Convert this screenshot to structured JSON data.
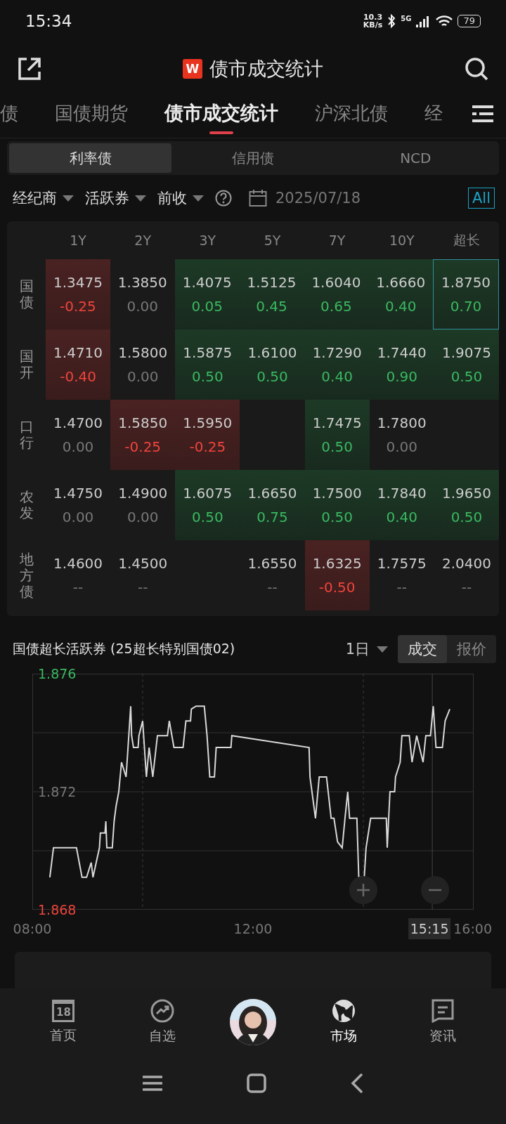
{
  "status_bar": {
    "time": "15:34",
    "net_speed": "10.3",
    "net_unit": "KB/s",
    "network": "5G",
    "battery": "79"
  },
  "header": {
    "logo": "W",
    "title": "债市成交统计"
  },
  "tabs": [
    {
      "label": "债",
      "selected": false
    },
    {
      "label": "国债期货",
      "selected": false
    },
    {
      "label": "债市成交统计",
      "selected": true
    },
    {
      "label": "沪深北债",
      "selected": false
    },
    {
      "label": "经",
      "selected": false
    }
  ],
  "segments": [
    {
      "label": "利率债",
      "selected": true
    },
    {
      "label": "信用债",
      "selected": false
    },
    {
      "label": "NCD",
      "selected": false
    }
  ],
  "filters": {
    "dropdowns": [
      "经纪商",
      "活跃券",
      "前收"
    ],
    "date": "2025/07/18",
    "all_button": "All"
  },
  "table": {
    "columns": [
      "1Y",
      "2Y",
      "3Y",
      "5Y",
      "7Y",
      "10Y",
      "超长"
    ],
    "rows": [
      {
        "name": "国债",
        "cells": [
          {
            "rate": "1.3475",
            "change": "-0.25",
            "kind": "down",
            "selected": false
          },
          {
            "rate": "1.3850",
            "change": "0.00",
            "kind": "flat",
            "selected": false
          },
          {
            "rate": "1.4075",
            "change": "0.05",
            "kind": "up",
            "selected": false
          },
          {
            "rate": "1.5125",
            "change": "0.45",
            "kind": "up",
            "selected": false
          },
          {
            "rate": "1.6040",
            "change": "0.65",
            "kind": "up",
            "selected": false
          },
          {
            "rate": "1.6660",
            "change": "0.40",
            "kind": "up",
            "selected": false
          },
          {
            "rate": "1.8750",
            "change": "0.70",
            "kind": "up",
            "selected": true
          }
        ]
      },
      {
        "name": "国开",
        "cells": [
          {
            "rate": "1.4710",
            "change": "-0.40",
            "kind": "down",
            "selected": false
          },
          {
            "rate": "1.5800",
            "change": "0.00",
            "kind": "flat",
            "selected": false
          },
          {
            "rate": "1.5875",
            "change": "0.50",
            "kind": "up",
            "selected": false
          },
          {
            "rate": "1.6100",
            "change": "0.50",
            "kind": "up",
            "selected": false
          },
          {
            "rate": "1.7290",
            "change": "0.40",
            "kind": "up",
            "selected": false
          },
          {
            "rate": "1.7440",
            "change": "0.90",
            "kind": "up",
            "selected": false
          },
          {
            "rate": "1.9075",
            "change": "0.50",
            "kind": "up",
            "selected": false
          }
        ]
      },
      {
        "name": "口行",
        "cells": [
          {
            "rate": "1.4700",
            "change": "0.00",
            "kind": "flat",
            "selected": false
          },
          {
            "rate": "1.5850",
            "change": "-0.25",
            "kind": "down",
            "selected": false
          },
          {
            "rate": "1.5950",
            "change": "-0.25",
            "kind": "down",
            "selected": false
          },
          {
            "selected": false
          },
          {
            "rate": "1.7475",
            "change": "0.50",
            "kind": "up",
            "selected": false
          },
          {
            "rate": "1.7800",
            "change": "0.00",
            "kind": "flat",
            "selected": false
          },
          {
            "selected": false
          }
        ]
      },
      {
        "name": "农发",
        "cells": [
          {
            "rate": "1.4750",
            "change": "0.00",
            "kind": "flat",
            "selected": false
          },
          {
            "rate": "1.4900",
            "change": "0.00",
            "kind": "flat",
            "selected": false
          },
          {
            "rate": "1.6075",
            "change": "0.50",
            "kind": "up",
            "selected": false
          },
          {
            "rate": "1.6650",
            "change": "0.75",
            "kind": "up",
            "selected": false
          },
          {
            "rate": "1.7500",
            "change": "0.50",
            "kind": "up",
            "selected": false
          },
          {
            "rate": "1.7840",
            "change": "0.40",
            "kind": "up",
            "selected": false
          },
          {
            "rate": "1.9650",
            "change": "0.50",
            "kind": "up",
            "selected": false
          }
        ]
      },
      {
        "name": "地方债",
        "cells": [
          {
            "rate": "1.4600",
            "change": "--",
            "kind": "flat",
            "selected": false
          },
          {
            "rate": "1.4500",
            "change": "--",
            "kind": "flat",
            "selected": false
          },
          {
            "selected": false
          },
          {
            "rate": "1.6550",
            "change": "--",
            "kind": "flat",
            "selected": false
          },
          {
            "rate": "1.6325",
            "change": "-0.50",
            "kind": "down",
            "selected": false
          },
          {
            "rate": "1.7575",
            "change": "--",
            "kind": "flat",
            "selected": false
          },
          {
            "rate": "2.0400",
            "change": "--",
            "kind": "flat",
            "selected": false
          }
        ]
      }
    ]
  },
  "chart": {
    "title": "国债超长活跃券 (25超长特别国债02)",
    "period": "1日",
    "modes": [
      {
        "label": "成交",
        "selected": true
      },
      {
        "label": "报价",
        "selected": false
      }
    ],
    "crosshair_label": "15:15",
    "chart_data": {
      "type": "line",
      "x": [
        8.317,
        8.383,
        8.8,
        8.9,
        8.983,
        9.067,
        9.1,
        9.217,
        9.233,
        9.317,
        9.333,
        9.35,
        9.45,
        9.483,
        9.517,
        9.567,
        9.617,
        9.7,
        9.717,
        9.783,
        9.8,
        9.833,
        9.917,
        9.933,
        10,
        10.067,
        10.117,
        10.183,
        10.267,
        10.317,
        10.45,
        10.483,
        10.567,
        10.733,
        10.783,
        10.867,
        10.883,
        10.967,
        11.117,
        11.167,
        11.217,
        11.3,
        11.333,
        11.6,
        11.617,
        13.017,
        13.033,
        13.133,
        13.2,
        13.333,
        13.417,
        13.467,
        13.533,
        13.617,
        13.667,
        13.717,
        13.75,
        13.883,
        13.917,
        14.017,
        14.05,
        14.133,
        14.417,
        14.433,
        14.483,
        14.567,
        14.583,
        14.667,
        14.7,
        14.833,
        14.883,
        14.967,
        15.083,
        15.133,
        15.217,
        15.267,
        15.317,
        15.433,
        15.483,
        15.567
      ],
      "series": [
        {
          "color": "#d9d9d9",
          "values": [
            1.8691,
            1.8701,
            1.8701,
            1.8691,
            1.8691,
            1.8696,
            1.8691,
            1.8701,
            1.8706,
            1.8706,
            1.871,
            1.8701,
            1.8701,
            1.871,
            1.8715,
            1.872,
            1.873,
            1.8725,
            1.873,
            1.8749,
            1.8739,
            1.8735,
            1.8735,
            1.8739,
            1.8744,
            1.8725,
            1.8735,
            1.8725,
            1.8739,
            1.8739,
            1.8739,
            1.8744,
            1.8735,
            1.8735,
            1.8744,
            1.8744,
            1.8748,
            1.8749,
            1.8749,
            1.8739,
            1.8725,
            1.8725,
            1.8735,
            1.8735,
            1.8739,
            1.8735,
            1.8725,
            1.8711,
            1.8725,
            1.8725,
            1.8711,
            1.8711,
            1.8703,
            1.8701,
            1.8711,
            1.872,
            1.8711,
            1.8711,
            1.8691,
            1.8691,
            1.8701,
            1.8711,
            1.8711,
            1.8701,
            1.872,
            1.872,
            1.8725,
            1.873,
            1.8739,
            1.8739,
            1.873,
            1.8739,
            1.873,
            1.8739,
            1.8739,
            1.8749,
            1.8735,
            1.8735,
            1.8744,
            1.8748
          ]
        }
      ],
      "xlim": [
        8,
        16
      ],
      "ylim": [
        1.868,
        1.876
      ],
      "xticks": [
        {
          "value": 8,
          "label": "08:00"
        },
        {
          "value": 12,
          "label": "12:00"
        },
        {
          "value": 16,
          "label": "16:00"
        }
      ],
      "yticks": [
        1.868,
        1.872,
        1.876
      ],
      "ref_lines": [
        {
          "axis": "x",
          "value": 10
        },
        {
          "axis": "x",
          "value": 14
        },
        {
          "axis": "x",
          "value": 15.25
        }
      ]
    }
  },
  "bottom_nav": [
    {
      "kind": "tab",
      "label": "首页",
      "icon_text": "18",
      "selected": false
    },
    {
      "kind": "tab",
      "label": "自选",
      "selected": false
    },
    {
      "kind": "avatar"
    },
    {
      "kind": "tab",
      "label": "市场",
      "selected": true
    },
    {
      "kind": "tab",
      "label": "资讯",
      "selected": false
    }
  ]
}
